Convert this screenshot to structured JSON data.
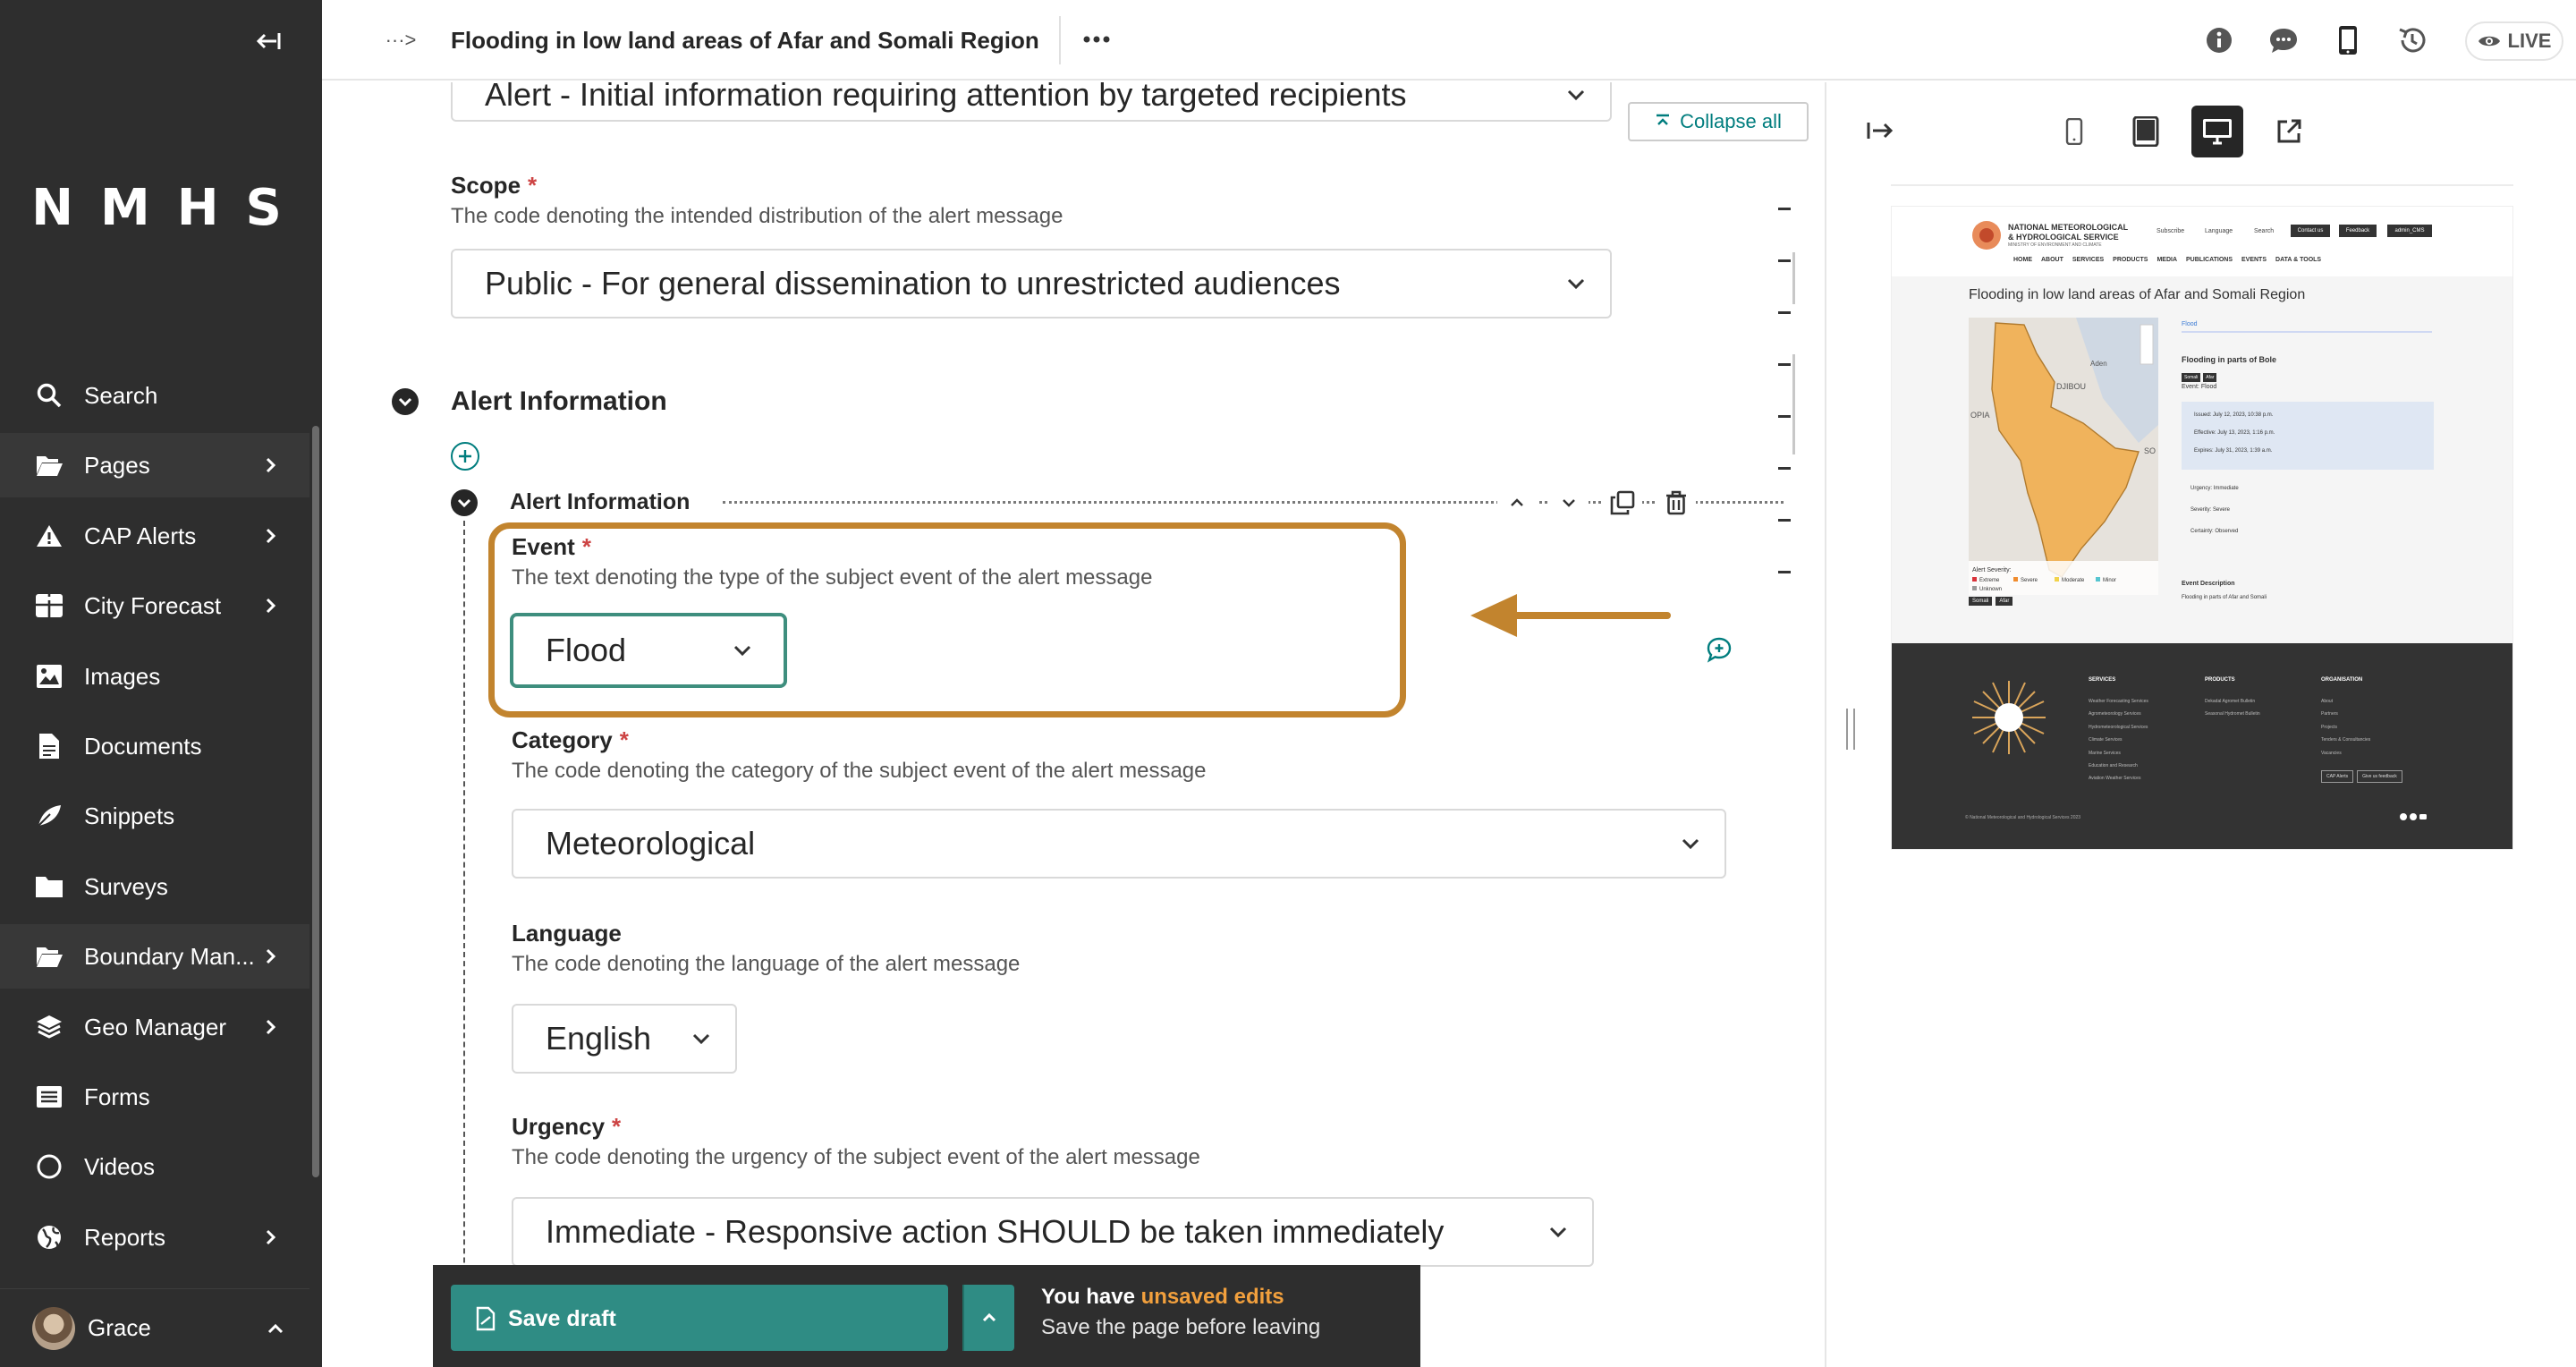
{
  "sidebar": {
    "logo": "NMHS",
    "items": [
      {
        "label": "Search",
        "icon": "search-icon",
        "has_children": false
      },
      {
        "label": "Pages",
        "icon": "folder-open-icon",
        "has_children": true
      },
      {
        "label": "CAP Alerts",
        "icon": "warning-icon",
        "has_children": true
      },
      {
        "label": "City Forecast",
        "icon": "table-icon",
        "has_children": true
      },
      {
        "label": "Images",
        "icon": "image-icon",
        "has_children": false
      },
      {
        "label": "Documents",
        "icon": "document-icon",
        "has_children": false
      },
      {
        "label": "Snippets",
        "icon": "snippet-icon",
        "has_children": false
      },
      {
        "label": "Surveys",
        "icon": "folder-icon",
        "has_children": false
      },
      {
        "label": "Boundary Man...",
        "icon": "folder-open-icon",
        "has_children": true
      },
      {
        "label": "Geo Manager",
        "icon": "layers-icon",
        "has_children": true
      },
      {
        "label": "Forms",
        "icon": "list-icon",
        "has_children": false
      },
      {
        "label": "Videos",
        "icon": "circle-icon",
        "has_children": false
      },
      {
        "label": "Reports",
        "icon": "globe-icon",
        "has_children": true
      }
    ],
    "account_name": "Grace"
  },
  "header": {
    "breadcrumb_toggle": "···>",
    "title": "Flooding in low land areas of Afar and Somali Region",
    "live_label": "LIVE"
  },
  "form": {
    "collapse_all": "Collapse all",
    "message_type_value": "Alert - Initial information requiring attention by targeted recipients",
    "scope": {
      "label": "Scope",
      "help": "The code denoting the intended distribution of the alert message",
      "value": "Public - For general dissemination to unrestricted audiences"
    },
    "section_title": "Alert Information",
    "block_title": "Alert Information",
    "event": {
      "label": "Event",
      "help": "The text denoting the type of the subject event of the alert message",
      "value": "Flood"
    },
    "category": {
      "label": "Category",
      "help": "The code denoting the category of the subject event of the alert message",
      "value": "Meteorological"
    },
    "language": {
      "label": "Language",
      "help": "The code denoting the language of the alert message",
      "value": "English"
    },
    "urgency": {
      "label": "Urgency",
      "help": "The code denoting the urgency of the subject event of the alert message",
      "value": "Immediate - Responsive action SHOULD be taken immediately"
    },
    "required_mark": "*"
  },
  "footer": {
    "save_label": "Save draft",
    "unsaved_prefix": "You have ",
    "unsaved_accent": "unsaved edits",
    "unsaved_sub": "Save the page before leaving"
  },
  "preview": {
    "site": {
      "org_line1": "NATIONAL METEOROLOGICAL",
      "org_line2": "& HYDROLOGICAL SERVICE",
      "org_line3": "MINISTRY OF ENVIRONMENT AND CLIMATE",
      "top_links": [
        "Subscribe",
        "Language",
        "Search",
        "Contact us",
        "Feedback",
        "admin_CMS"
      ],
      "nav": [
        "HOME",
        "ABOUT",
        "SERVICES",
        "PRODUCTS",
        "MEDIA",
        "PUBLICATIONS",
        "EVENTS",
        "DATA & TOOLS"
      ],
      "page_title": "Flooding in low land areas of Afar and Somali Region",
      "event_chip": "Flood",
      "area_title": "Flooding in parts of Bole",
      "chips": [
        "Somali",
        "Afar"
      ],
      "event_line": "Event:",
      "event_value": "Flood",
      "issued": "Issued: July 12, 2023, 10:38 p.m.",
      "effective": "Effective: July 13, 2023, 1:16 p.m.",
      "expires": "Expires: July 31, 2023, 1:39 a.m.",
      "urgency": "Urgency: Immediate",
      "severity": "Severity: Severe",
      "certainty": "Certainty: Observed",
      "event_desc_title": "Event Description",
      "event_desc": "Flooding in parts of Afar and Somali",
      "map_labels": [
        "DJIBOU",
        "Aden",
        "OPIA",
        "SO"
      ],
      "legend_title": "Alert Severity:",
      "legend_items": [
        "Extreme",
        "Severe",
        "Moderate",
        "Minor",
        "Unknown"
      ],
      "map_chips": [
        "Somali",
        "Afar"
      ],
      "footer_cols": [
        {
          "title": "SERVICES",
          "items": [
            "Weather Forecasting Services",
            "Agrometeorology Services",
            "Hydrometeorological Services",
            "Climate Services",
            "Marine Services",
            "Education and Research",
            "Aviation Weather Services"
          ]
        },
        {
          "title": "PRODUCTS",
          "items": [
            "Dekadal Agromet Bulletin",
            "Seasonal Hydromet Bulletin"
          ]
        },
        {
          "title": "ORGANISATION",
          "items": [
            "About",
            "Partners",
            "Projects",
            "Tenders & Consultancies",
            "Vacancies"
          ]
        }
      ],
      "footer_buttons": [
        "CAP Alerts",
        "Give us feedback"
      ],
      "copyright": "© National Meteorological and Hydrological Services 2023"
    }
  },
  "colors": {
    "sidebar_bg": "#2e2e2e",
    "teal": "#2f8c84",
    "highlight": "#c2842e",
    "map_fill": "#f0b35c"
  }
}
